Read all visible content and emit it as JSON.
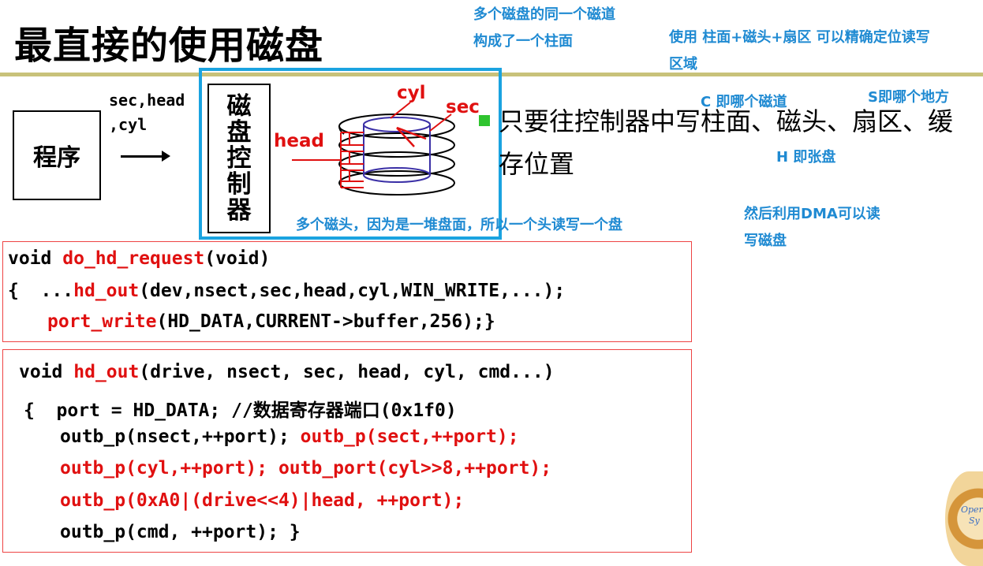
{
  "slide": {
    "title": "最直接的使用磁盘"
  },
  "notes": {
    "cylinder_note_line1": "多个磁盘的同一个磁道",
    "cylinder_note_line2": "构成了一个柱面",
    "locate_note_line1": "使用 柱面+磁头+扇区  可以精确定位读写",
    "locate_note_line2": "区域",
    "c_note": "C 即哪个磁道",
    "s_note": "S即哪个地方",
    "h_note": "H 即张盘",
    "dma_note_line1": "然后利用DMA可以读",
    "dma_note_line2": "写磁盘",
    "heads_note": "多个磁头，因为是一堆盘面，所以一个头读写一个盘"
  },
  "diagram": {
    "program_label": "程序",
    "params_line1": "sec,head",
    "params_line2": ",cyl",
    "controller_chars": [
      "磁",
      "盘",
      "控",
      "制",
      "器"
    ],
    "cyl_label": "cyl",
    "sec_label": "sec",
    "head_label": "head"
  },
  "bullet": {
    "line1": "只要往控制器中写柱面、磁头、扇区、缓",
    "line2": "存位置"
  },
  "code1": {
    "line1_kw": "void ",
    "line1_fn": "do_hd_request",
    "line1_rest": "(void)",
    "line2_a": "{  ...",
    "line2_fn": "hd_out",
    "line2_rest": "(dev,nsect,sec,head,cyl,WIN_WRITE,...);",
    "line3_fn": "port_write",
    "line3_rest": "(HD_DATA,CURRENT->buffer,256);}"
  },
  "code2": {
    "line1_kw": "void ",
    "line1_fn": "hd_out",
    "line1_rest": "(drive, nsect, sec, head, cyl, cmd...)",
    "line2": "{  port = HD_DATA; //数据寄存器端口(0x1f0)",
    "line3_a": "outb_p(nsect,++port); ",
    "line3_b": "outb_p(sect,++port);",
    "line4": "outb_p(cyl,++port); outb_port(cyl>>8,++port);",
    "line5": "outb_p(0xA0|(drive<<4)|head, ++port);",
    "line6": "outb_p(cmd, ++port); }"
  },
  "logo": {
    "text1": "Oper",
    "text2": "Sy"
  }
}
